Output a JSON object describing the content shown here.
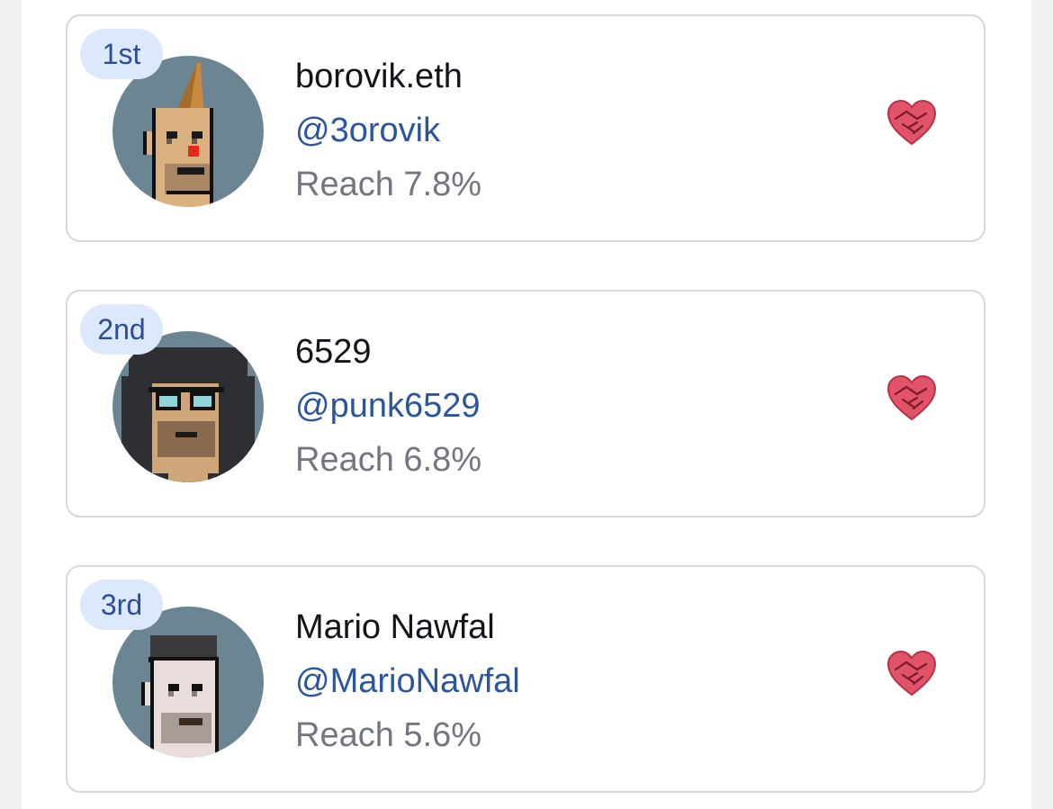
{
  "entries": [
    {
      "rank": "1st",
      "name": "borovik.eth",
      "handle": "@3orovik",
      "reach": "Reach 7.8%",
      "avatar_icon": "mohawk-punk-avatar-icon",
      "action_icon": "heart-handshake-icon"
    },
    {
      "rank": "2nd",
      "name": "6529",
      "handle": "@punk6529",
      "reach": "Reach 6.8%",
      "avatar_icon": "hoodie-punk-avatar-icon",
      "action_icon": "heart-handshake-icon"
    },
    {
      "rank": "3rd",
      "name": "Mario Nawfal",
      "handle": "@MarioNawfal",
      "reach": "Reach 5.6%",
      "avatar_icon": "beanie-punk-avatar-icon",
      "action_icon": "heart-handshake-icon"
    }
  ],
  "colors": {
    "badge_bg": "#dce8fb",
    "badge_text": "#2b4e99",
    "handle": "#2c55a0",
    "reach": "#72767f",
    "avatar_bg": "#6c8592",
    "heart": "#e05368"
  }
}
